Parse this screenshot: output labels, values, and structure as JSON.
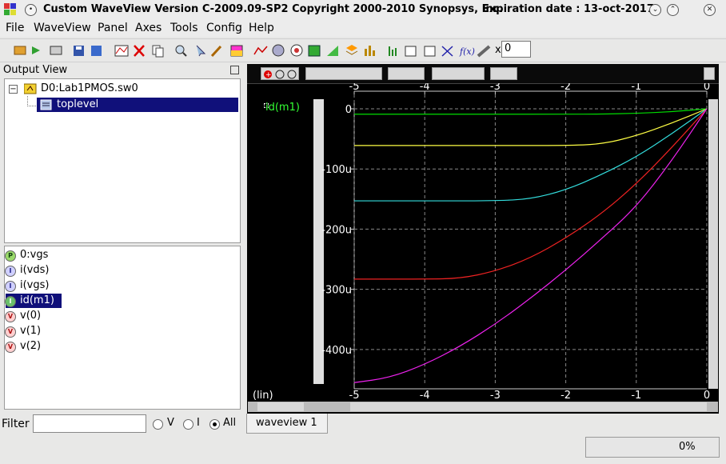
{
  "window": {
    "title": "Custom WaveView Version C-2009.09-SP2 Copyright 2000-2010 Synopsys, Inc.",
    "expiration": "Expiration date : 13-oct-2017",
    "buttons": [
      "minimize-icon",
      "maximize-icon",
      "close-icon"
    ]
  },
  "menu": {
    "items": [
      "File",
      "WaveView",
      "Panel",
      "Axes",
      "Tools",
      "Config",
      "Help"
    ]
  },
  "toolbar": {
    "x_label": "x",
    "x_value": "0"
  },
  "output_view": {
    "title": "Output View",
    "tree": {
      "root": "D0:Lab1PMOS.sw0",
      "child": "toplevel"
    },
    "signals": [
      {
        "badge": "P",
        "name": "0:vgs",
        "color": "#3a9a3a"
      },
      {
        "badge": "I",
        "name": "i(vds)",
        "color": "#4a4aaa"
      },
      {
        "badge": "I",
        "name": "i(vgs)",
        "color": "#4a4aaa"
      },
      {
        "badge": "I",
        "name": "id(m1)",
        "color": "#2a8a2a",
        "selected": true
      },
      {
        "badge": "V",
        "name": "v(0)",
        "color": "#cc2222"
      },
      {
        "badge": "V",
        "name": "v(1)",
        "color": "#cc2222"
      },
      {
        "badge": "V",
        "name": "v(2)",
        "color": "#cc2222"
      }
    ],
    "filter_label": "Filter",
    "filter_options": [
      "V",
      "I",
      "All"
    ],
    "filter_selected": "All"
  },
  "waveform": {
    "signal_name": "id(m1)",
    "x_scale": "(lin)",
    "tab": "waveview 1",
    "progress_text": "0%",
    "progress": 0
  },
  "chart_data": {
    "type": "line",
    "xlim": [
      -5,
      0
    ],
    "ylim": [
      -460,
      0
    ],
    "x_ticks": [
      "-5",
      "-4",
      "-3",
      "-2",
      "-1",
      "0"
    ],
    "y_ticks": [
      "0",
      "-100u",
      "-200u",
      "-300u",
      "-400u"
    ],
    "y_tick_values": [
      0,
      -100,
      -200,
      -300,
      -400
    ],
    "grid": true,
    "series": [
      {
        "color": "#00dd00",
        "x": [
          -5,
          -4,
          -3,
          -2,
          -1.5,
          -1,
          -0.5,
          0
        ],
        "y": [
          -9,
          -9,
          -9,
          -9,
          -8.8,
          -7.5,
          -5,
          0
        ]
      },
      {
        "color": "#ffff44",
        "x": [
          -5,
          -4,
          -3,
          -2,
          -1.5,
          -1,
          -0.5,
          0
        ],
        "y": [
          -61,
          -61,
          -61,
          -61,
          -59,
          -45,
          -24,
          0
        ]
      },
      {
        "color": "#33dddd",
        "x": [
          -5,
          -4,
          -3,
          -2.5,
          -2,
          -1.5,
          -1,
          -0.5,
          0
        ],
        "y": [
          -153,
          -153,
          -153,
          -150,
          -135,
          -110,
          -80,
          -42,
          0
        ]
      },
      {
        "color": "#ee2222",
        "x": [
          -5,
          -4,
          -3.5,
          -3,
          -2.5,
          -2,
          -1.5,
          -1,
          -0.5,
          0
        ],
        "y": [
          -283,
          -283,
          -282,
          -270,
          -248,
          -215,
          -175,
          -125,
          -65,
          0
        ]
      },
      {
        "color": "#ee22ee",
        "x": [
          -5,
          -4.5,
          -4,
          -3.5,
          -3,
          -2.5,
          -2,
          -1.5,
          -1,
          -0.5,
          0
        ],
        "y": [
          -455,
          -447,
          -425,
          -395,
          -358,
          -315,
          -268,
          -217,
          -163,
          -87,
          0
        ]
      }
    ]
  }
}
